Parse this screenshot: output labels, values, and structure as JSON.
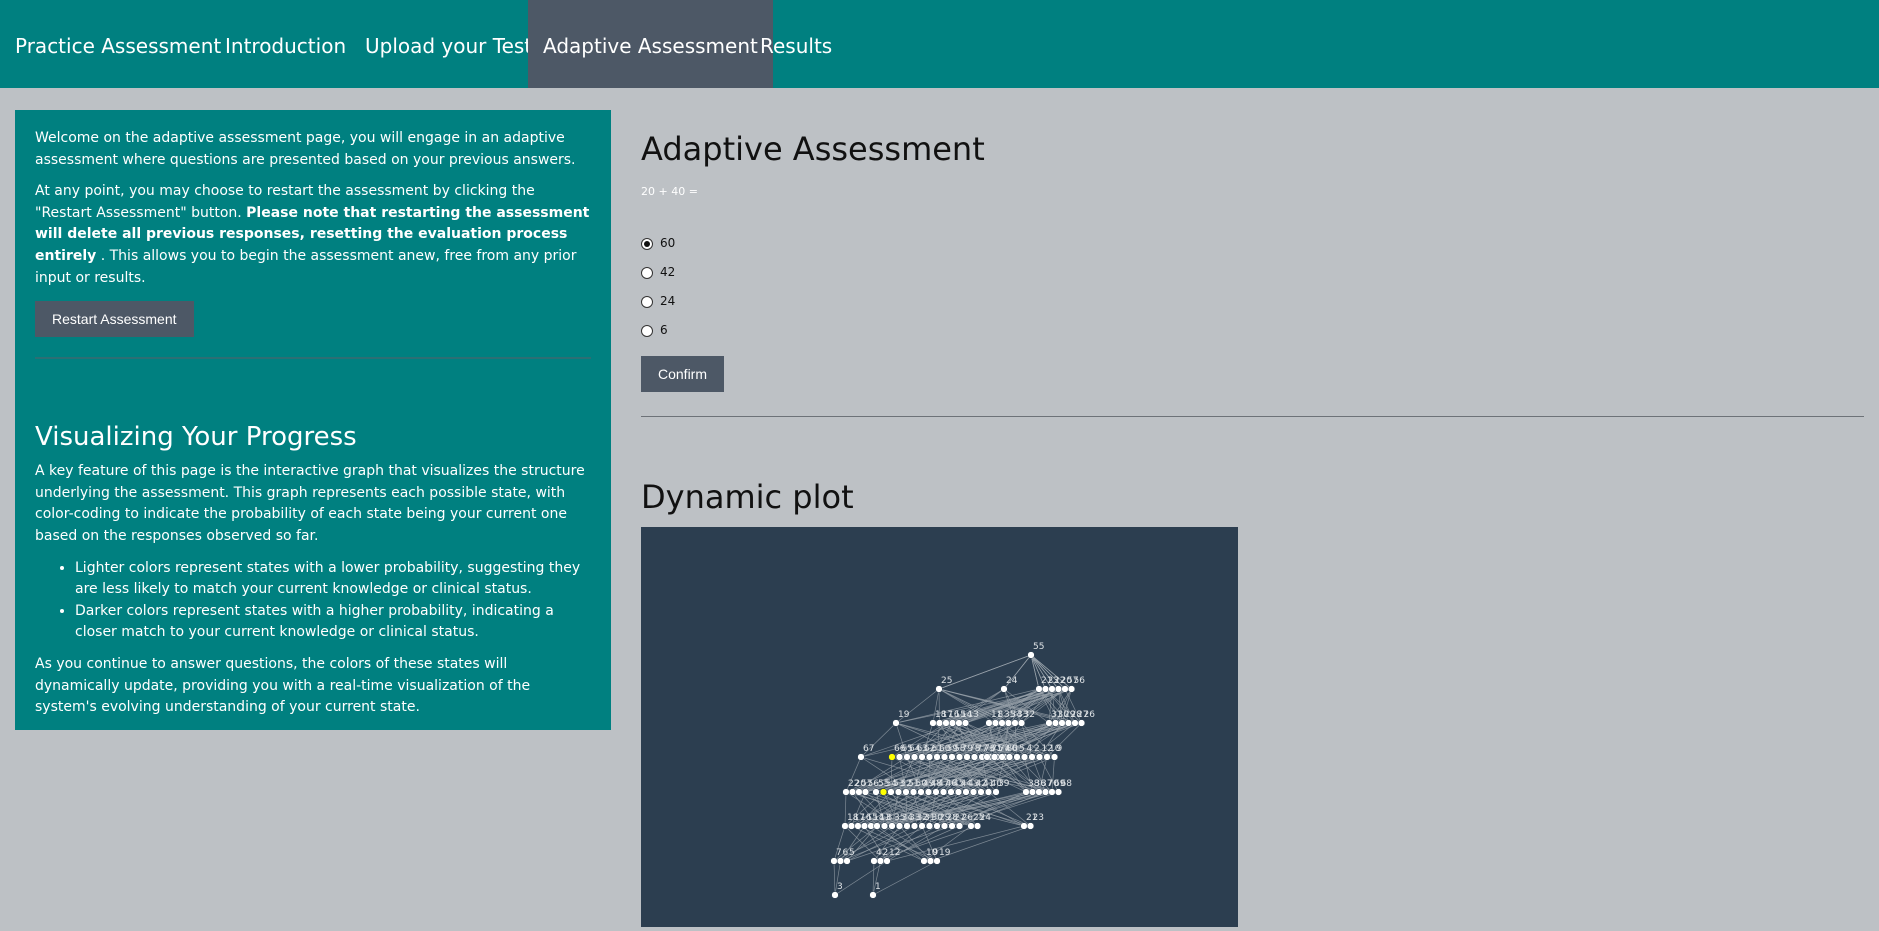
{
  "nav": {
    "items": [
      {
        "label": "Practice Assessment"
      },
      {
        "label": "Introduction"
      },
      {
        "label": "Upload your Test"
      },
      {
        "label": "Adaptive Assessment",
        "active": true
      },
      {
        "label": "Results"
      }
    ]
  },
  "sidebar": {
    "intro": "Welcome on the adaptive assessment page, you will engage in an adaptive assessment where questions are presented based on your previous answers.",
    "restart_p1": "At any point, you may choose to restart the assessment by clicking the \"Restart Assessment\" button.",
    "restart_bold": "Please note that restarting the assessment will delete all previous responses, resetting the evaluation process entirely",
    "restart_p2": ". This allows you to begin the assessment anew, free from any prior input or results.",
    "restart_button": "Restart Assessment",
    "viz_heading": "Visualizing Your Progress",
    "viz_p1": "A key feature of this page is the interactive graph that visualizes the structure underlying the assessment. This graph represents each possible state, with color-coding to indicate the probability of each state being your current one based on the responses observed so far.",
    "bullets": [
      "Lighter colors represent states with a lower probability, suggesting they are less likely to match your current knowledge or clinical status.",
      "Darker colors represent states with a higher probability, indicating a closer match to your current knowledge or clinical status."
    ],
    "viz_p2": "As you continue to answer questions, the colors of these states will dynamically update, providing you with a real-time visualization of the system's evolving understanding of your current state."
  },
  "main": {
    "title": "Adaptive Assessment",
    "question": "20 + 40 =",
    "options": [
      {
        "label": "60",
        "checked": true
      },
      {
        "label": "42",
        "checked": false
      },
      {
        "label": "24",
        "checked": false
      },
      {
        "label": "6",
        "checked": false
      }
    ],
    "confirm_button": "Confirm",
    "plot_title": "Dynamic plot"
  },
  "graph": {
    "background": "#2c3e50",
    "node_color": "#ffffff",
    "highlight_color": "#ffff00",
    "edge_color": "#9aa3ab",
    "node_labels": [
      "80",
      "74",
      "75",
      "76",
      "77",
      "78",
      "79",
      "58",
      "59",
      "60",
      "61",
      "62",
      "63",
      "64",
      "65",
      "66",
      "67",
      "68",
      "69",
      "70",
      "37",
      "36",
      "38",
      "39",
      "40",
      "41",
      "42",
      "43",
      "44",
      "45",
      "46",
      "47",
      "48",
      "49",
      "50",
      "51",
      "52",
      "53",
      "54",
      "55",
      "56",
      "57",
      "20",
      "22",
      "23",
      "21",
      "24",
      "25",
      "26",
      "27",
      "28",
      "29",
      "30",
      "31",
      "32",
      "33",
      "34",
      "35",
      "8",
      "11",
      "13",
      "14",
      "15",
      "16",
      "17",
      "18",
      "19",
      "9",
      "10",
      "12",
      "2",
      "4",
      "5",
      "6",
      "7",
      "1",
      "3"
    ]
  }
}
